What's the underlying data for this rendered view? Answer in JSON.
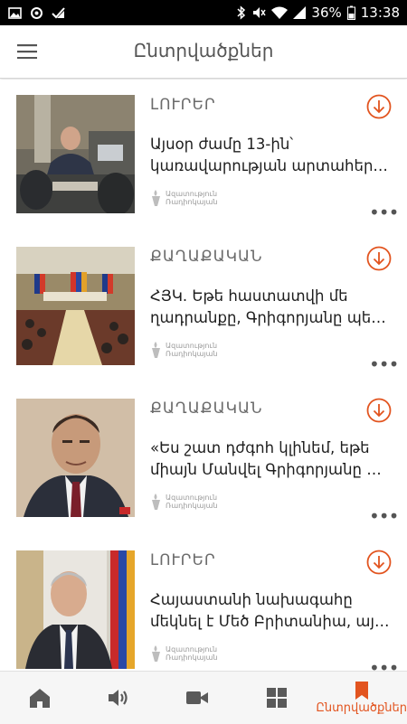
{
  "status_bar": {
    "battery": "36%",
    "time": "13:38",
    "left_icons": [
      "image-icon",
      "sync-icon",
      "check-icon"
    ],
    "right_icons": [
      "bluetooth-icon",
      "mute-icon",
      "wifi-icon",
      "signal-icon",
      "battery-icon"
    ]
  },
  "app_bar": {
    "title": "Ընտրվածքներ",
    "menu_icon": "hamburger-menu-icon"
  },
  "accent_color": "#e2541f",
  "articles": [
    {
      "category": "ԼՈՒՐԵՐ",
      "headline_lines": [
        "Այսօր ժամը 13-ին՝",
        "կառավարության արտահերթ..."
      ],
      "source_lines": [
        "Ազատություն",
        "Ռադիոկայան"
      ]
    },
    {
      "category": "ՔԱՂԱՔԱԿԱՆ",
      "headline_lines": [
        "ՀՅԿ. Եթե հաստատվի մե",
        "ղադրանքը, Գրիգորյանը պետ..."
      ],
      "source_lines": [
        "Ազատություն",
        "Ռադիոկայան"
      ]
    },
    {
      "category": "ՔԱՂԱՔԱԿԱՆ",
      "headline_lines": [
        "«Ես շատ դժգոհ կլինեմ, եթե",
        "միայն Մանվել Գրիգորյանը պ..."
      ],
      "source_lines": [
        "Ազատություն",
        "Ռադիոկայան"
      ]
    },
    {
      "category": "ԼՈՒՐԵՐ",
      "headline_lines": [
        "Հայաստանի նախագահը",
        "մեկնել է Մեծ Բրիտանիա, այց..."
      ],
      "source_lines": [
        "Ազատություն",
        "Ռադիոկայան"
      ]
    }
  ],
  "bottom_nav": {
    "items": [
      {
        "icon": "home-icon"
      },
      {
        "icon": "speaker-icon"
      },
      {
        "icon": "video-camera-icon"
      },
      {
        "icon": "grid-icon"
      },
      {
        "icon": "bookmark-icon",
        "label": "Ընտրվածքներ",
        "active": true
      }
    ]
  }
}
